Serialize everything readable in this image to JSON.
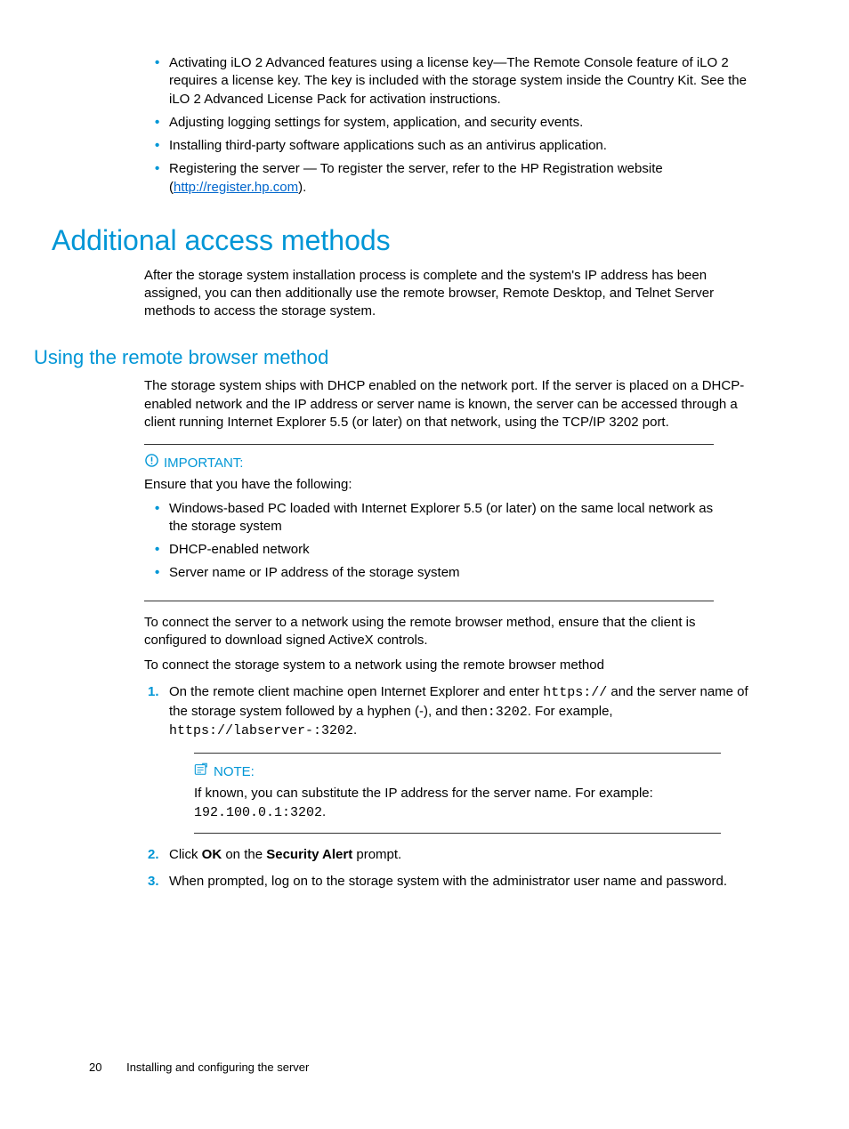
{
  "top_bullets": {
    "b1": "Activating iLO 2 Advanced features using a license key—The Remote Console feature of iLO 2 requires a license key. The key is included with the storage system inside the Country Kit. See the iLO 2 Advanced License Pack for activation instructions.",
    "b2": "Adjusting logging settings for system, application, and security events.",
    "b3": "Installing third-party software applications such as an antivirus application.",
    "b4_pre": "Registering the server — To register the server, refer to the HP Registration website (",
    "b4_link": "http://register.hp.com",
    "b4_post": ")."
  },
  "h_additional": "Additional access methods",
  "p_additional": "After the storage system installation process is complete and the system's IP address has been assigned, you can then additionally use the remote browser, Remote Desktop, and Telnet Server methods to access the storage system.",
  "h_remote": "Using the remote browser method",
  "p_remote": "The storage system ships with DHCP enabled on the network port. If the server is placed on a DHCP-enabled network and the IP address or server name is known, the server can be accessed through a client running Internet Explorer 5.5 (or later) on that network, using the TCP/IP 3202 port.",
  "important": {
    "label": "IMPORTANT:",
    "intro": "Ensure that you have the following:",
    "i1": "Windows-based PC loaded with Internet Explorer 5.5 (or later) on the same local network as the storage system",
    "i2": "DHCP-enabled network",
    "i3": "Server name or IP address of the storage system"
  },
  "p_connect1": "To connect the server to a network using the remote browser method, ensure that the client is configured to download signed ActiveX controls.",
  "p_connect2": "To connect the storage system to a network using the remote browser method",
  "step1": {
    "t1": "On the remote client machine open Internet Explorer and enter ",
    "c1": "https://",
    "t2": " and the server name of the storage system followed by a hyphen (-), and then",
    "c2": ":3202",
    "t3": ". For example, ",
    "c3": "https://labserver-:3202",
    "t4": "."
  },
  "note": {
    "label": "NOTE:",
    "t1": "If known, you can substitute the IP address for the server name. For example: ",
    "c1": "192.100.0.1:3202",
    "t2": "."
  },
  "step2": {
    "t1": "Click ",
    "b1": "OK",
    "t2": " on the ",
    "b2": "Security Alert",
    "t3": " prompt."
  },
  "step3": "When prompted, log on to the storage system with the administrator user name and password.",
  "footer": {
    "page": "20",
    "title": "Installing and configuring the server"
  }
}
